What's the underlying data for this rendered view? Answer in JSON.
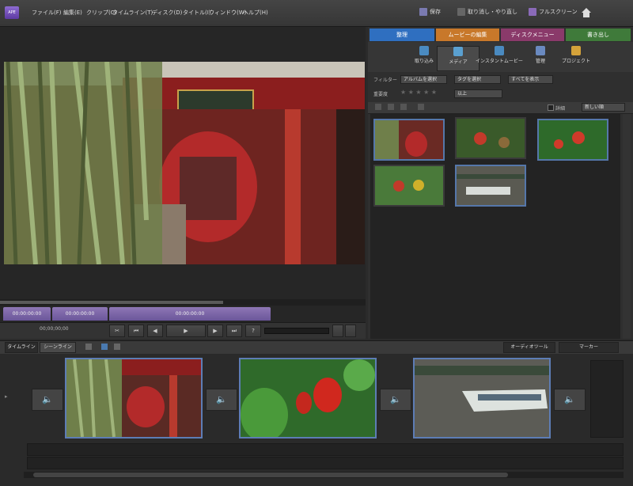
{
  "app": {
    "logo_text": "APE"
  },
  "menu": [
    "ファイル(F)",
    "編集(E)",
    "クリップ(C)",
    "タイムライン(T)",
    "ディスク(D)",
    "タイトル(I)",
    "ウィンドウ(W)",
    "ヘルプ(H)"
  ],
  "topbar": {
    "save_label": "保存",
    "undo_label": "取り消し・やり直し",
    "fullscreen_label": "フルスクリーン"
  },
  "panel_tabs": [
    {
      "label": "整理",
      "color": "#2f6fc0"
    },
    {
      "label": "ムービーの編集",
      "color": "#c8782a"
    },
    {
      "label": "ディスクメニュー",
      "color": "#8a3a6a"
    },
    {
      "label": "書き出し",
      "color": "#3f7a3a"
    }
  ],
  "sub_tabs": [
    "取り込み",
    "メディア",
    "インスタントムービー",
    "管理",
    "プロジェクト"
  ],
  "filter": {
    "label": "フィルター",
    "album": "アルバムを選択",
    "media_type": "タグを選択",
    "show_all": "すべてを表示"
  },
  "rating": {
    "label": "重要度",
    "stars": "★ ★ ★ ★ ★",
    "value": "以上"
  },
  "view_options": {
    "checkbox_label": "詳細",
    "sort_label": "新しい順"
  },
  "clip_tabs": [
    "00:00:00:00",
    "00:00:00:00",
    "00:00:00:00"
  ],
  "timecode": "00;00;00;00",
  "timeline": {
    "tab_timeline": "タイムライン",
    "tab_sceneline": "シーンライン",
    "audio_tool": "オーディオツール",
    "marker": "マーカー"
  },
  "icons": {
    "save": "save-icon",
    "undo": "undo-icon",
    "fullscreen": "fullscreen-icon",
    "home": "home-icon",
    "speaker": "speaker-icon",
    "play": "play-icon"
  }
}
